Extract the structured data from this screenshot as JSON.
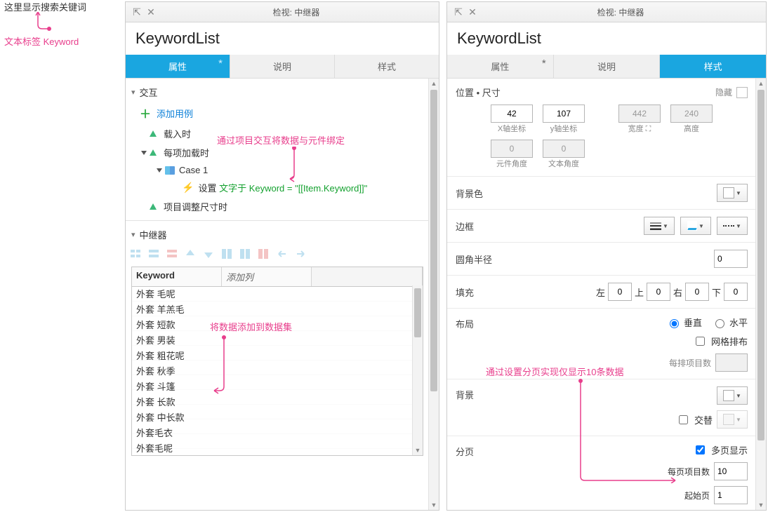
{
  "leftNote": {
    "top_text": "这里显示搜索关键词",
    "bottom_label": "文本标签 Keyword"
  },
  "inspector_title": "检视: 中继器",
  "panelLeft": {
    "header": "KeywordList",
    "tabs": [
      {
        "label": "属性",
        "dirty": true
      },
      {
        "label": "说明",
        "dirty": false
      },
      {
        "label": "样式",
        "dirty": false
      }
    ],
    "active_tab": 0,
    "section_interaction_title": "交互",
    "interaction": {
      "add_case": "添加用例",
      "events": {
        "onload": {
          "label": "载入时"
        },
        "onitemload": {
          "label": "每项加载时",
          "case": {
            "name": "Case 1",
            "action_label": "设置",
            "action_expr": "文字于 Keyword = \"[[Item.Keyword]]\""
          }
        },
        "onresize": {
          "label": "项目调整尺寸时"
        }
      },
      "note": "通过项目交互将数据与元件绑定"
    },
    "section_repeater_title": "中继器",
    "data_table": {
      "col_keyword": "Keyword",
      "col_add": "添加列",
      "rows": [
        "外套 毛呢",
        "外套 羊羔毛",
        "外套 短款",
        "外套 男装",
        "外套 粗花呢",
        "外套 秋季",
        "外套 斗篷",
        "外套 长款",
        "外套 中长款",
        "外套毛衣",
        "外套毛呢"
      ],
      "note": "将数据添加到数据集"
    }
  },
  "panelRight": {
    "header": "KeywordList",
    "tabs": [
      {
        "label": "属性",
        "dirty": true
      },
      {
        "label": "说明",
        "dirty": false
      },
      {
        "label": "样式",
        "dirty": false
      }
    ],
    "active_tab": 2,
    "section_pos": {
      "title": "位置 • 尺寸",
      "hide_label": "隐藏",
      "x": "42",
      "x_label": "X轴坐标",
      "y": "107",
      "y_label": "y轴坐标",
      "w": "442",
      "w_label": "宽度",
      "h": "240",
      "h_label": "高度",
      "widget_angle": "0",
      "widget_angle_label": "元件角度",
      "text_angle": "0",
      "text_angle_label": "文本角度"
    },
    "bgcolor_label": "背景色",
    "border_label": "边框",
    "radius_label": "圆角半径",
    "radius_value": "0",
    "padding": {
      "label": "填充",
      "l_label": "左",
      "l": "0",
      "t_label": "上",
      "t": "0",
      "r_label": "右",
      "r": "0",
      "b_label": "下",
      "b": "0"
    },
    "layout": {
      "label": "布局",
      "vertical": "垂直",
      "horizontal": "水平",
      "wrap": "网格排布",
      "per_row_label": "每排项目数"
    },
    "background": {
      "label": "背景",
      "alt_label": "交替",
      "note": "通过设置分页实现仅显示10条数据"
    },
    "pagination": {
      "label": "分页",
      "multi_label": "多页显示",
      "per_page_label": "每页项目数",
      "per_page": "10",
      "start_label": "起始页",
      "start": "1"
    }
  }
}
